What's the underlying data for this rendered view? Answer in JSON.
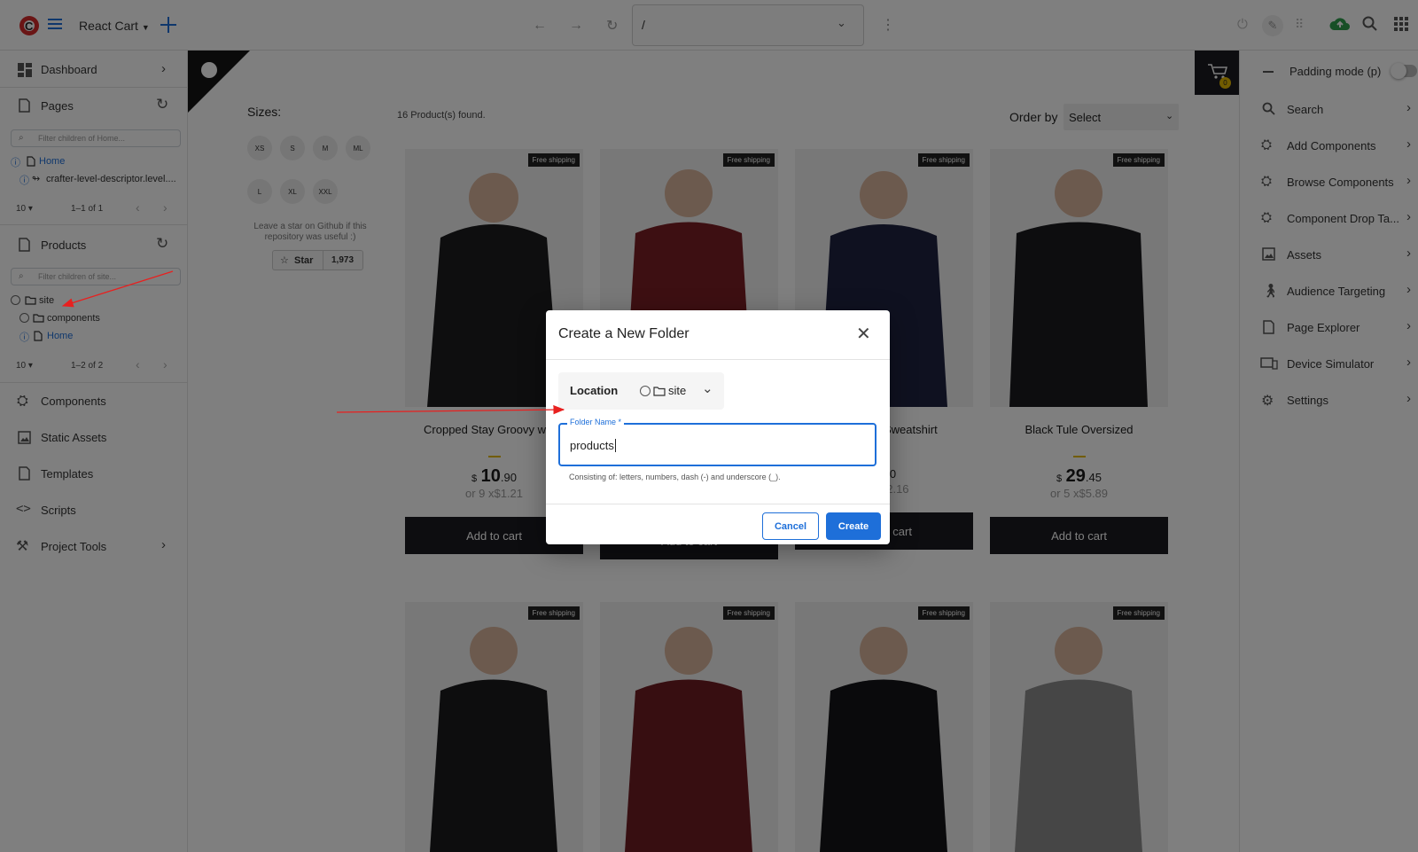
{
  "topbar": {
    "site_name": "React Cart",
    "address": "/"
  },
  "sidebar": {
    "dashboard": "Dashboard",
    "pages": "Pages",
    "pages_filter_placeholder": "Filter children of Home...",
    "pages_tree": [
      {
        "label": "Home"
      },
      {
        "label": "crafter-level-descriptor.level...."
      }
    ],
    "pages_pager": {
      "per_page": "10",
      "range": "1–1 of 1"
    },
    "products": "Products",
    "products_filter_placeholder": "Filter children of site...",
    "products_tree": [
      {
        "label": "site"
      },
      {
        "label": "components"
      },
      {
        "label": "Home"
      }
    ],
    "products_pager": {
      "per_page": "10",
      "range": "1–2 of 2"
    },
    "components": "Components",
    "static_assets": "Static Assets",
    "templates": "Templates",
    "scripts": "Scripts",
    "project_tools": "Project Tools"
  },
  "preview": {
    "sizes_label": "Sizes:",
    "sizes": [
      "XS",
      "S",
      "M",
      "ML",
      "L",
      "XL",
      "XXL"
    ],
    "github_note": "Leave a star on Github if this repository was useful :)",
    "star_label": "Star",
    "star_count": "1,973",
    "found": "16 Product(s) found.",
    "order_by_label": "Order by",
    "order_by_value": "Select",
    "cart_count": "0",
    "free_shipping": "Free shipping",
    "add_to_cart": "Add to cart",
    "products": [
      {
        "title": "Cropped Stay Groovy white",
        "currency": "$",
        "int": "10",
        "dec": ".90",
        "installments": "or 9 x",
        "inst_price": "$1.21",
        "shirt": "#1d1d1f"
      },
      {
        "title": "",
        "currency": "$",
        "int": "",
        "dec": "",
        "installments": "",
        "inst_price": "",
        "shirt": "#7a1f24"
      },
      {
        "title": "Sweatshirt",
        "currency": "",
        "int": "",
        "dec": ".90",
        "installments": "",
        "inst_price": "$2.16",
        "shirt": "#1f2340"
      },
      {
        "title": "Black Tule Oversized",
        "currency": "$",
        "int": "29",
        "dec": ".45",
        "installments": "or 5 x",
        "inst_price": "$5.89",
        "shirt": "#1b1b1f"
      },
      {
        "shirt": "#1a1a1c"
      },
      {
        "shirt": "#6e1c22"
      },
      {
        "shirt": "#151518"
      },
      {
        "shirt": "#8c8c8c"
      }
    ]
  },
  "rightbar": {
    "padding_mode": "Padding mode (p)",
    "items": [
      "Search",
      "Add Components",
      "Browse Components",
      "Component Drop Ta...",
      "Assets",
      "Audience Targeting",
      "Page Explorer",
      "Device Simulator",
      "Settings"
    ]
  },
  "dialog": {
    "title": "Create a New Folder",
    "location_label": "Location",
    "location_value": "site",
    "field_label": "Folder Name *",
    "field_value": "products",
    "helper": "Consisting of: letters, numbers, dash (-) and underscore (_).",
    "cancel": "Cancel",
    "create": "Create"
  },
  "colors": {
    "accent": "#1e6fd9",
    "annotation_arrow": "#e8201f"
  }
}
